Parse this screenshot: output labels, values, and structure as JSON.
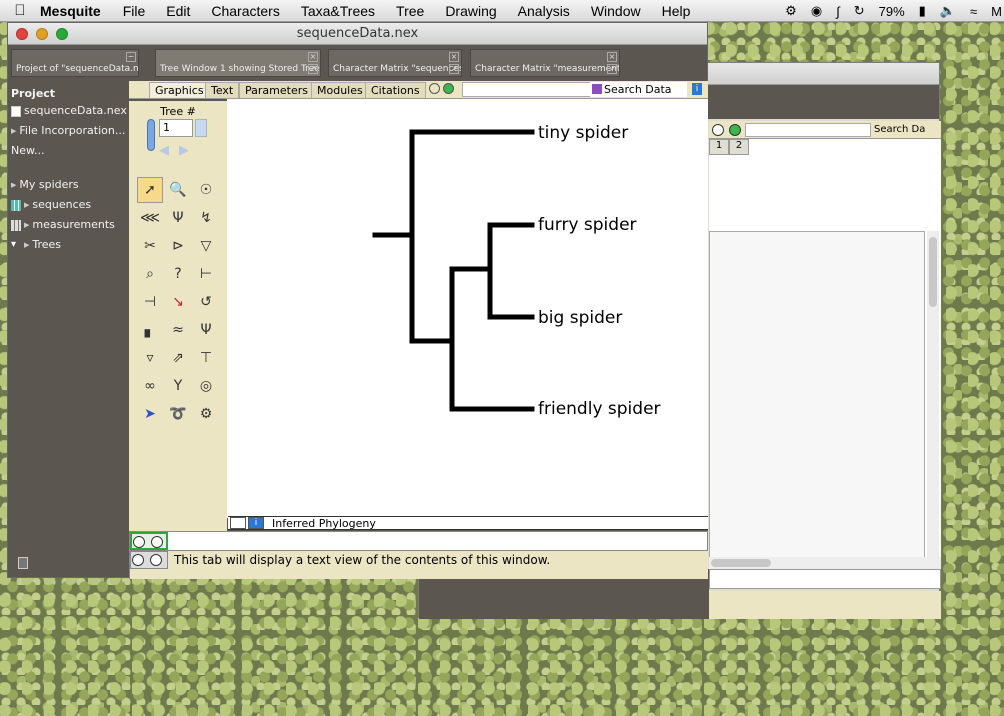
{
  "menubar": {
    "app": "Mesquite",
    "items": [
      "File",
      "Edit",
      "Characters",
      "Taxa&Trees",
      "Tree",
      "Drawing",
      "Analysis",
      "Window",
      "Help"
    ],
    "battery": "79%",
    "extra": "M"
  },
  "window": {
    "title": "sequenceData.nex",
    "tabs": [
      "Project of \"sequenceData.nex\"",
      "Tree Window 1 showing Stored Trees",
      "Character Matrix \"sequences\"",
      "Character Matrix \"measurements\""
    ]
  },
  "sidebar": {
    "header": "Project",
    "items": [
      {
        "label": "sequenceData.nex",
        "icon": "document-icon"
      },
      {
        "label": "File Incorporation...",
        "icon": "triangle-icon"
      },
      {
        "label": "New...",
        "icon": ""
      },
      {
        "label": "My spiders",
        "icon": "triangle-icon"
      },
      {
        "label": "sequences",
        "icon": "matrix-icon"
      },
      {
        "label": "measurements",
        "icon": "matrix-icon"
      },
      {
        "label": "Trees",
        "icon": "tree-icon"
      }
    ]
  },
  "graphics_tabs": [
    "Graphics",
    "Text",
    "Parameters",
    "Modules",
    "Citations"
  ],
  "search": {
    "label": "Search Data"
  },
  "palette": {
    "tree_label": "Tree #",
    "tree_number": "1"
  },
  "tree": {
    "taxa": [
      "tiny spider",
      "furry spider",
      "big spider",
      "friendly spider"
    ],
    "footer": "Inferred Phylogeny"
  },
  "text_tab_message": "This tab will display a text view of the contents of this window.",
  "back_window": {
    "search_label": "Search Da",
    "columns": [
      "1",
      "2"
    ]
  }
}
